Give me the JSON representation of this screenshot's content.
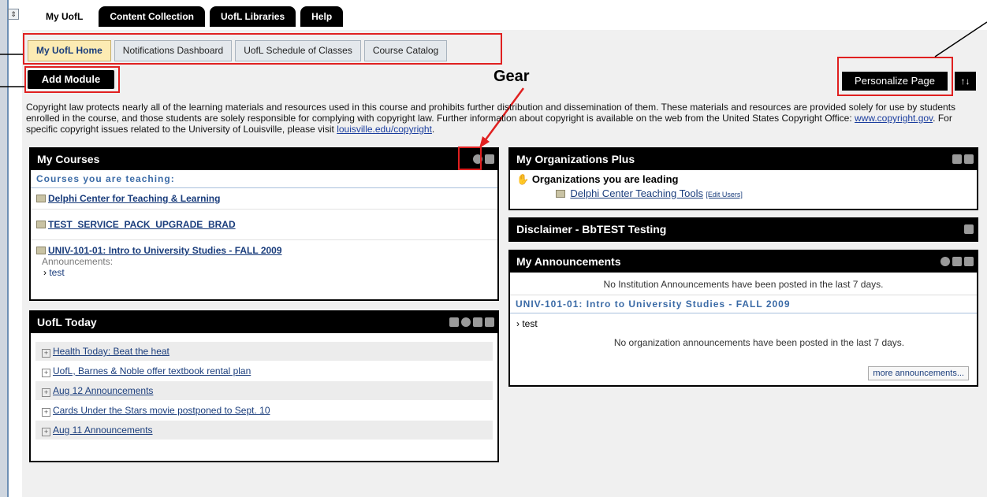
{
  "top_tabs": [
    {
      "label": "My UofL"
    },
    {
      "label": "Content Collection"
    },
    {
      "label": "UofL Libraries"
    },
    {
      "label": "Help"
    }
  ],
  "sub_tabs": [
    {
      "label": "My UofL Home"
    },
    {
      "label": "Notifications Dashboard"
    },
    {
      "label": "UofL Schedule of Classes"
    },
    {
      "label": "Course Catalog"
    }
  ],
  "toolbar": {
    "add_module": "Add Module",
    "personalize": "Personalize Page",
    "reorder": "↑↓"
  },
  "annotation": {
    "gear": "Gear"
  },
  "copyright": {
    "text1": "Copyright law protects nearly all of the learning materials and resources used in this course and prohibits further distribution and dissemination of them. These materials and resources are provided solely for use by students enrolled in the course, and those students are solely responsible for complying with copyright law. Further information about copyright is available on the web from the United States Copyright Office: ",
    "link1": "www.copyright.gov",
    "text2": ". For specific copyright issues related to the University of Louisville, please visit ",
    "link2": "louisville.edu/copyright",
    "text3": "."
  },
  "my_courses": {
    "title": "My Courses",
    "section": "Courses you are teaching:",
    "courses": [
      {
        "name": "Delphi Center for Teaching & Learning"
      },
      {
        "name": "TEST_SERVICE_PACK_UPGRADE_BRAD"
      },
      {
        "name": "UNIV-101-01: Intro to University Studies - FALL 2009"
      }
    ],
    "announcements_label": "Announcements:",
    "announcement_item": "test"
  },
  "uofl_today": {
    "title": "UofL Today",
    "items": [
      {
        "label": "Health Today: Beat the heat"
      },
      {
        "label": "UofL, Barnes & Noble offer textbook rental plan"
      },
      {
        "label": "Aug 12 Announcements"
      },
      {
        "label": "Cards Under the Stars movie postponed to Sept. 10"
      },
      {
        "label": "Aug 11 Announcements"
      }
    ]
  },
  "my_orgs": {
    "title": "My Organizations Plus",
    "heading": "Organizations you are leading",
    "org": "Delphi Center Teaching Tools",
    "edit_users": "[Edit Users]"
  },
  "disclaimer": {
    "title": "Disclaimer - BbTEST Testing"
  },
  "my_announcements": {
    "title": "My Announcements",
    "no_institution": "No Institution Announcements have been posted in the last 7 days.",
    "course_section": "UNIV-101-01: Intro to University Studies - FALL 2009",
    "item": "test",
    "no_org": "No organization announcements have been posted in the last 7 days.",
    "more": "more announcements..."
  }
}
